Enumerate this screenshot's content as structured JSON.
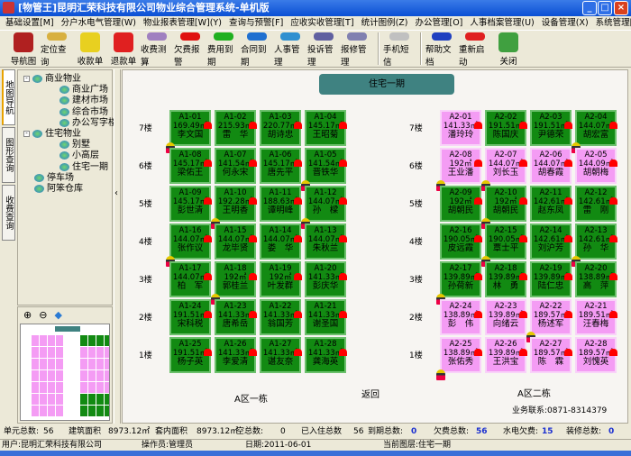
{
  "window": {
    "title": "[物管王]昆明汇荣科技有限公司物业综合管理系统-单机版"
  },
  "menu": [
    "基础设置[M]",
    "分户水电气管理(W)",
    "物业报表管理[W](Y)",
    "查询与预警[F]",
    "应收实收管理[T]",
    "统计图例(Z)",
    "办公管理[O]",
    "人事档案管理(U)",
    "设备管理(X)",
    "系统管理[S]"
  ],
  "toolbar": [
    {
      "label": "导航图",
      "icon": "sitemap-icon",
      "color": "#b02020"
    },
    {
      "label": "定位查询",
      "icon": "magnifier-icon",
      "color": "#d8b040"
    },
    {
      "label": "收款单",
      "icon": "receipt-icon",
      "color": "#e8d020"
    },
    {
      "label": "退款单",
      "icon": "refund-icon",
      "color": "#e02020"
    },
    {
      "label": "收费测算",
      "icon": "calculator-icon",
      "color": "#a080c0"
    },
    {
      "label": "欠费报警",
      "icon": "red-alarm-icon",
      "color": "#e01010"
    },
    {
      "label": "费用到期",
      "icon": "green-alarm-icon",
      "color": "#20b020"
    },
    {
      "label": "合同到期",
      "icon": "blue-alarm-icon",
      "color": "#2070d0"
    },
    {
      "label": "人事管理",
      "icon": "users-icon",
      "color": "#3090d0"
    },
    {
      "label": "投诉管理",
      "icon": "complaint-icon",
      "color": "#6060a0"
    },
    {
      "label": "报修管理",
      "icon": "repair-icon",
      "color": "#8080b0"
    },
    {
      "label": "手机短信",
      "icon": "sms-icon",
      "color": "#c0c0c0"
    },
    {
      "label": "帮助文档",
      "icon": "help-icon",
      "color": "#2040c0"
    },
    {
      "label": "重新启动",
      "icon": "restart-icon",
      "color": "#e02020"
    },
    {
      "label": "关闭",
      "icon": "exit-icon",
      "color": "#40a040"
    }
  ],
  "vtabs": [
    "地图导航",
    "图形查询",
    "收费查询"
  ],
  "tree": [
    {
      "label": "商业物业",
      "level": 0,
      "expander": "-"
    },
    {
      "label": "商业广场",
      "level": 1
    },
    {
      "label": "建材市场",
      "level": 1
    },
    {
      "label": "综合市场",
      "level": 1
    },
    {
      "label": "办公写字楼",
      "level": 1
    },
    {
      "label": "住宅物业",
      "level": 0,
      "expander": "-"
    },
    {
      "label": "别墅",
      "level": 1
    },
    {
      "label": "小高层",
      "level": 1
    },
    {
      "label": "住宅一期",
      "level": 1,
      "selected": true
    },
    {
      "label": "停车场",
      "level": 0
    },
    {
      "label": "阿笨仓库",
      "level": 0
    }
  ],
  "main": {
    "title": "住宅一期",
    "back": "返回",
    "contact": "业务联系:0871-8314379",
    "floors": [
      "7楼",
      "6楼",
      "5楼",
      "4楼",
      "3楼",
      "2楼",
      "1楼"
    ],
    "colors": {
      "occupied": "#128a12",
      "arrears": "#f49cf4"
    },
    "buildings": [
      {
        "name": "A区一栋",
        "rows": [
          [
            [
              "A1-01",
              "169.49㎡",
              "李文国",
              "g",
              1
            ],
            [
              "A1-02",
              "215.93㎡",
              "雷　华",
              "g",
              0
            ],
            [
              "A1-03",
              "220.77㎡",
              "胡诗忠",
              "g",
              0
            ],
            [
              "A1-04",
              "145.17㎡",
              "王昭菊",
              "g",
              0
            ]
          ],
          [
            [
              "A1-08",
              "145.17㎡",
              "梁佑王",
              "g",
              0
            ],
            [
              "A1-07",
              "141.54㎡",
              "何永宋",
              "g",
              0
            ],
            [
              "A1-06",
              "145.17㎡",
              "唐先平",
              "g",
              0
            ],
            [
              "A1-05",
              "141.54㎡",
              "晋铁华",
              "g",
              1
            ]
          ],
          [
            [
              "A1-09",
              "145.17㎡",
              "彭世清",
              "g",
              0
            ],
            [
              "A1-10",
              "192.28㎡",
              "王明香",
              "g",
              1
            ],
            [
              "A1-11",
              "188.63㎡",
              "谭明峰",
              "g",
              0
            ],
            [
              "A1-12",
              "144.07㎡",
              "孙　樑",
              "g",
              1
            ]
          ],
          [
            [
              "A1-16",
              "144.07㎡",
              "张作议",
              "g",
              1
            ],
            [
              "A1-15",
              "144.07㎡",
              "龙毕贤",
              "g",
              0
            ],
            [
              "A1-14",
              "144.07㎡",
              "娄　华",
              "g",
              0
            ],
            [
              "A1-13",
              "144.07㎡",
              "朱秋兰",
              "g",
              0
            ]
          ],
          [
            [
              "A1-17",
              "144.07㎡",
              "柏　军",
              "g",
              0
            ],
            [
              "A1-18",
              "192㎡",
              "郭桂兰",
              "g",
              1
            ],
            [
              "A1-19",
              "192㎡",
              "叶发群",
              "g",
              0
            ],
            [
              "A1-20",
              "141.33㎡",
              "彭庆华",
              "g",
              0
            ]
          ],
          [
            [
              "A1-24",
              "191.51㎡",
              "宋科税",
              "g",
              0
            ],
            [
              "A1-23",
              "141.33㎡",
              "唐希岳",
              "g",
              0
            ],
            [
              "A1-22",
              "141.33㎡",
              "翁国芳",
              "g",
              0
            ],
            [
              "A1-21",
              "141.33㎡",
              "谢圣国",
              "g",
              0
            ]
          ],
          [
            [
              "A1-25",
              "191.51㎡",
              "杨子英",
              "g",
              0
            ],
            [
              "A1-26",
              "141.33㎡",
              "李爱清",
              "g",
              0
            ],
            [
              "A1-27",
              "141.33㎡",
              "谌友奈",
              "g",
              0
            ],
            [
              "A1-28",
              "141.33㎡",
              "龚海英",
              "g",
              0
            ]
          ]
        ]
      },
      {
        "name": "A区二栋",
        "rows": [
          [
            [
              "A2-01",
              "141.33㎡",
              "潘玲玲",
              "p",
              0
            ],
            [
              "A2-02",
              "191.51㎡",
              "陈国庆",
              "g",
              0
            ],
            [
              "A2-03",
              "191.51㎡",
              "尹德荣",
              "g",
              0
            ],
            [
              "A2-04",
              "144.07㎡",
              "胡宏富",
              "g",
              1
            ]
          ],
          [
            [
              "A2-08",
              "192㎡",
              "王业潘",
              "p",
              1
            ],
            [
              "A2-07",
              "144.07㎡",
              "刘长玉",
              "p",
              1
            ],
            [
              "A2-06",
              "144.07㎡",
              "胡春霞",
              "p",
              0
            ],
            [
              "A2-05",
              "144.09㎡",
              "胡朝梅",
              "p",
              0
            ]
          ],
          [
            [
              "A2-09",
              "192㎡",
              "胡朝民",
              "g",
              0
            ],
            [
              "A2-10",
              "192㎡",
              "胡朝民",
              "g",
              1
            ],
            [
              "A2-11",
              "142.61㎡",
              "赵东凤",
              "g",
              0
            ],
            [
              "A2-12",
              "142.61㎡",
              "雷　刚",
              "g",
              0
            ]
          ],
          [
            [
              "A2-16",
              "190.05㎡",
              "皮远霞",
              "g",
              0
            ],
            [
              "A2-15",
              "190.05㎡",
              "覃士平",
              "g",
              1
            ],
            [
              "A2-14",
              "142.61㎡",
              "刘沪芳",
              "g",
              0
            ],
            [
              "A2-13",
              "142.61㎡",
              "孙　华",
              "g",
              1
            ]
          ],
          [
            [
              "A2-17",
              "139.89㎡",
              "孙荷新",
              "g",
              1
            ],
            [
              "A2-18",
              "139.89㎡",
              "林　勇",
              "g",
              0
            ],
            [
              "A2-19",
              "139.89㎡",
              "陆仁忠",
              "g",
              0
            ],
            [
              "A2-20",
              "138.89㎡",
              "高　萍",
              "g",
              0
            ]
          ],
          [
            [
              "A2-24",
              "138.89㎡",
              "彭　伟",
              "p",
              0
            ],
            [
              "A2-23",
              "139.89㎡",
              "向绪云",
              "p",
              0
            ],
            [
              "A2-22",
              "189.57㎡",
              "杨述军",
              "p",
              1
            ],
            [
              "A2-21",
              "189.51㎡",
              "汪春梅",
              "p",
              0
            ]
          ],
          [
            [
              "A2-25",
              "138.89㎡",
              "张佑秀",
              "p",
              1
            ],
            [
              "A2-26",
              "139.89㎡",
              "王洪宝",
              "p",
              0
            ],
            [
              "A2-27",
              "189.57㎡",
              "陈　霖",
              "p",
              0
            ],
            [
              "A2-28",
              "189.57㎡",
              "刘愧英",
              "p",
              0
            ]
          ]
        ]
      }
    ]
  },
  "stats": {
    "units_label": "单元总数:",
    "units": "56",
    "area_label": "建筑面积",
    "area": "8973.12㎡",
    "inner_label": "套内面积",
    "inner": "8973.12㎡",
    "empty_label": "空总数:",
    "empty": "0",
    "occupied_label": "已入住总数",
    "occupied": "56",
    "due_label": "到期总数:",
    "due": "0",
    "arrears_label": "欠费总数:",
    "arrears": "56",
    "utility_label": "水电欠费:",
    "utility": "15",
    "decor_label": "装修总数:",
    "decor": "0"
  },
  "status": {
    "user": "用户:昆明汇荣科技有限公司",
    "operator": "操作员:管理员",
    "date": "日期:2011-06-01",
    "layer": "当前图层:住宅一期"
  }
}
